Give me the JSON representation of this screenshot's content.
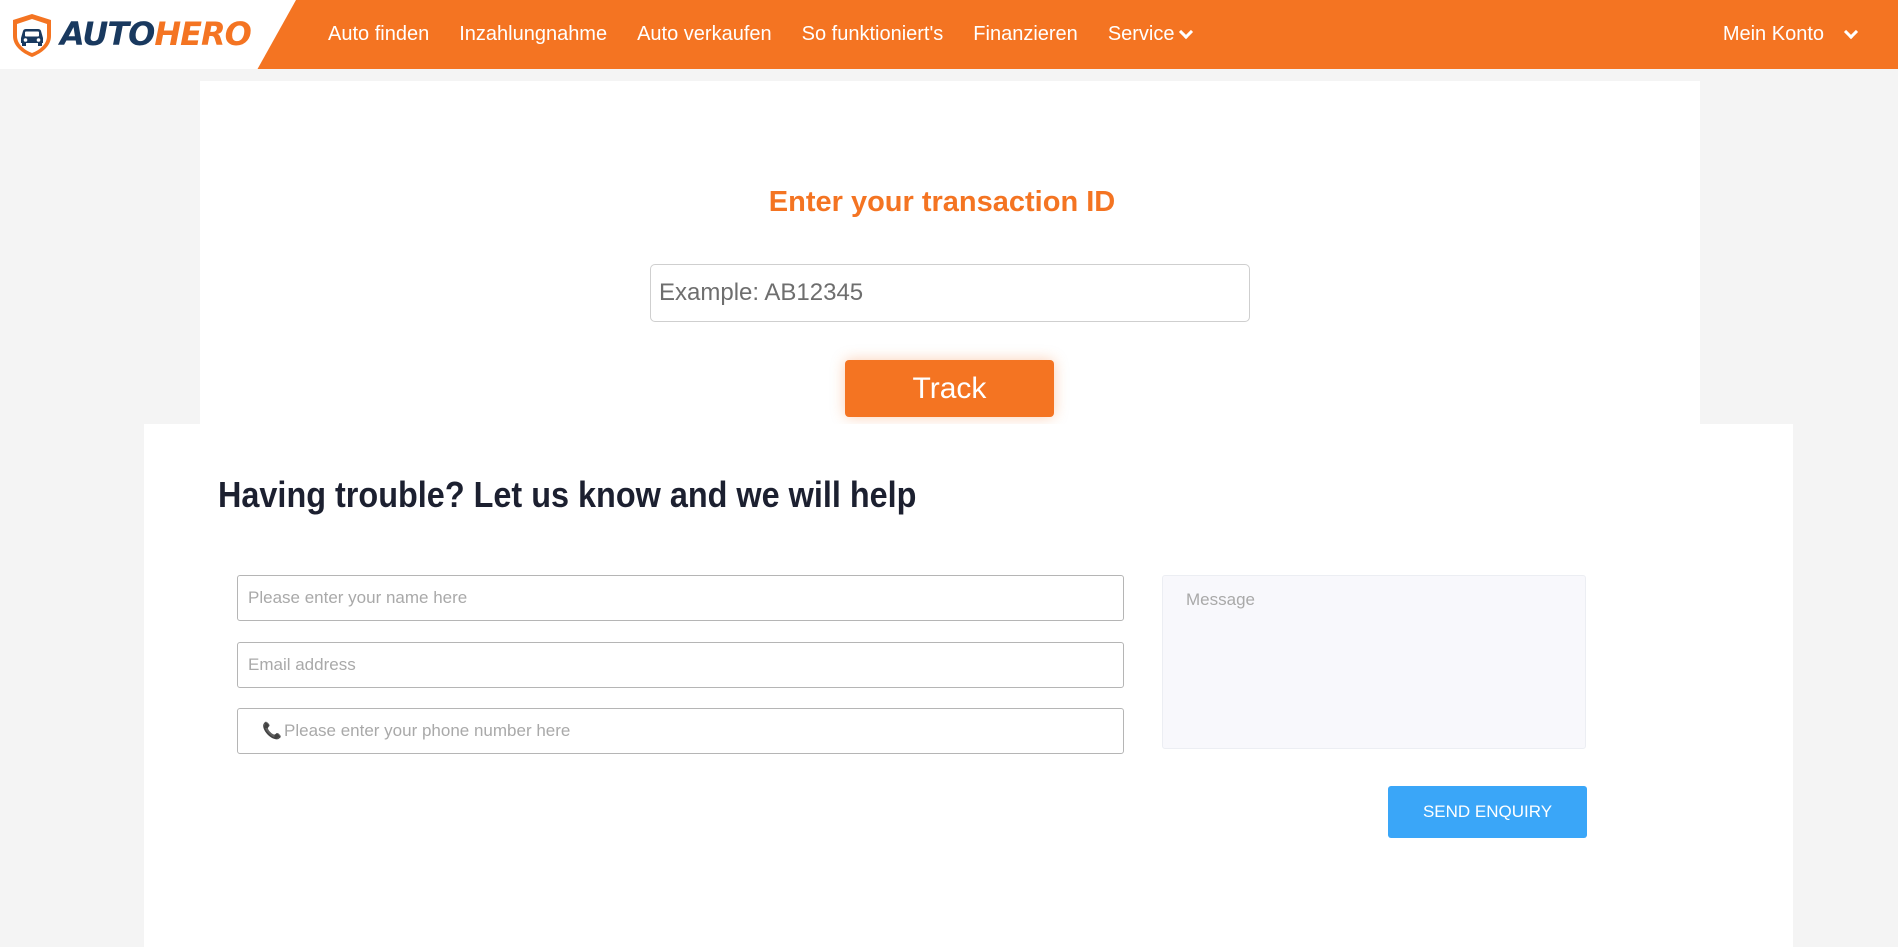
{
  "brand": {
    "logo_part1": "AUTO",
    "logo_part2": "HERO",
    "primary_color": "#f47422",
    "navy_color": "#19395f",
    "icon": "car-shield-logo-icon"
  },
  "nav": {
    "items": [
      {
        "label": "Auto finden"
      },
      {
        "label": "Inzahlungnahme"
      },
      {
        "label": "Auto verkaufen"
      },
      {
        "label": "So funktioniert's"
      },
      {
        "label": "Finanzieren"
      },
      {
        "label": "Service",
        "dropdown": true
      }
    ],
    "account_label": "Mein Konto",
    "dropdown_icon": "chevron-down-icon"
  },
  "tracking": {
    "title": "Enter your transaction ID",
    "input_placeholder": "Example: AB12345",
    "input_value": "",
    "button_label": "Track"
  },
  "help": {
    "title": "Having trouble? Let us know and we will help",
    "name_placeholder": "Please enter your name here",
    "email_placeholder": "Email address",
    "phone_placeholder": "Please enter your phone number here",
    "phone_icon": "phone-icon",
    "message_placeholder": "Message",
    "send_label": "SEND ENQUIRY",
    "send_color": "#3aa6f8"
  }
}
